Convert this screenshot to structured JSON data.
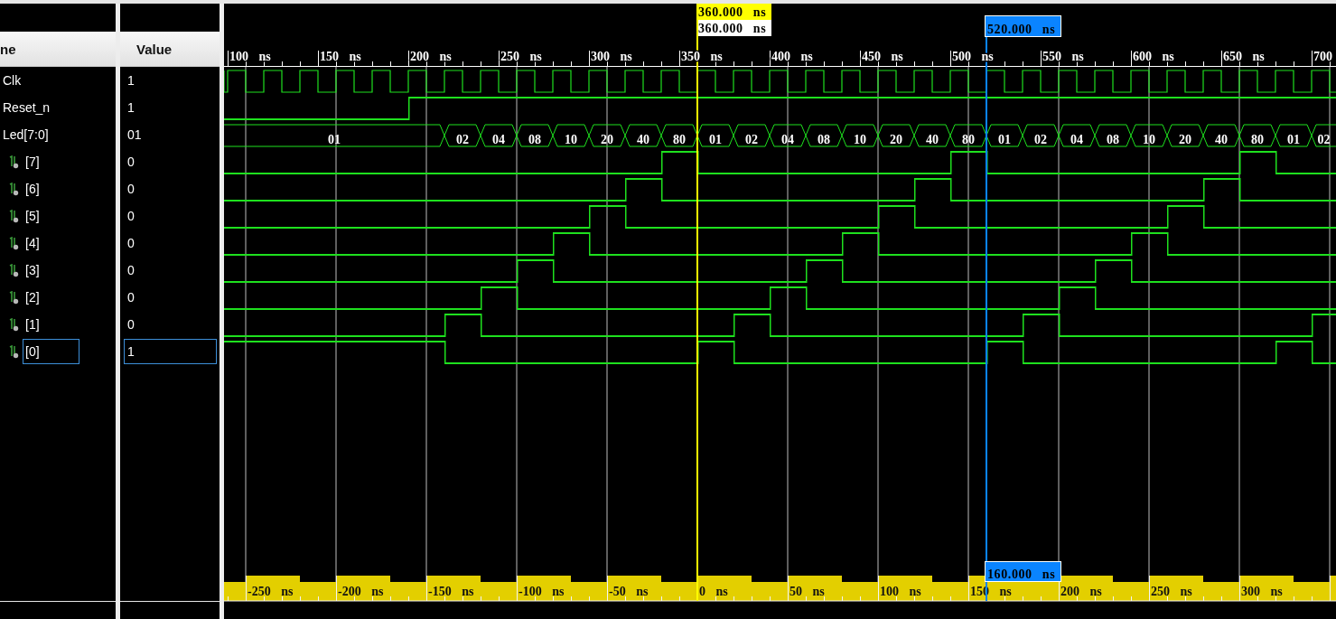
{
  "columns": {
    "name": "ne",
    "value": "Value"
  },
  "signals": [
    {
      "name": "Clk",
      "value": "1",
      "kind": "clock",
      "selected": false
    },
    {
      "name": "Reset_n",
      "value": "1",
      "kind": "bit",
      "selected": false,
      "high": [
        false,
        false,
        false,
        false,
        false,
        false,
        true,
        true,
        true,
        true,
        true,
        true,
        true,
        true,
        true,
        true,
        true,
        true,
        true,
        true,
        true,
        true,
        true,
        true,
        true,
        true,
        true,
        true,
        true,
        true,
        true,
        true
      ]
    },
    {
      "name": "Led[7:0]",
      "value": "01",
      "kind": "bus",
      "selected": false,
      "changes": [
        true,
        false,
        false,
        false,
        false,
        false,
        false,
        true,
        true,
        true,
        true,
        true,
        true,
        true,
        true,
        true,
        true,
        true,
        true,
        true,
        true,
        true,
        true,
        true,
        true,
        true,
        true,
        true,
        true,
        true,
        true,
        true
      ],
      "data": [
        "01",
        "02",
        "04",
        "08",
        "10",
        "20",
        "40",
        "80",
        "01",
        "02",
        "04",
        "08",
        "10",
        "20",
        "40",
        "80",
        "01",
        "02",
        "04",
        "08",
        "10",
        "20",
        "40",
        "80",
        "01",
        "02"
      ],
      "children": [
        {
          "name": "[7]",
          "value": "0",
          "kind": "bit",
          "selected": false,
          "high": [
            false,
            false,
            false,
            false,
            false,
            false,
            false,
            false,
            false,
            false,
            false,
            false,
            false,
            true,
            false,
            false,
            false,
            false,
            false,
            false,
            false,
            true,
            false,
            false,
            false,
            false,
            false,
            false,
            false,
            true,
            false,
            false
          ]
        },
        {
          "name": "[6]",
          "value": "0",
          "kind": "bit",
          "selected": false,
          "high": [
            false,
            false,
            false,
            false,
            false,
            false,
            false,
            false,
            false,
            false,
            false,
            false,
            true,
            false,
            false,
            false,
            false,
            false,
            false,
            false,
            true,
            false,
            false,
            false,
            false,
            false,
            false,
            false,
            true,
            false,
            false,
            false
          ]
        },
        {
          "name": "[5]",
          "value": "0",
          "kind": "bit",
          "selected": false,
          "high": [
            false,
            false,
            false,
            false,
            false,
            false,
            false,
            false,
            false,
            false,
            false,
            true,
            false,
            false,
            false,
            false,
            false,
            false,
            false,
            true,
            false,
            false,
            false,
            false,
            false,
            false,
            false,
            true,
            false,
            false,
            false,
            false
          ]
        },
        {
          "name": "[4]",
          "value": "0",
          "kind": "bit",
          "selected": false,
          "high": [
            false,
            false,
            false,
            false,
            false,
            false,
            false,
            false,
            false,
            false,
            true,
            false,
            false,
            false,
            false,
            false,
            false,
            false,
            true,
            false,
            false,
            false,
            false,
            false,
            false,
            false,
            true,
            false,
            false,
            false,
            false,
            false
          ]
        },
        {
          "name": "[3]",
          "value": "0",
          "kind": "bit",
          "selected": false,
          "high": [
            false,
            false,
            false,
            false,
            false,
            false,
            false,
            false,
            false,
            true,
            false,
            false,
            false,
            false,
            false,
            false,
            false,
            true,
            false,
            false,
            false,
            false,
            false,
            false,
            false,
            true,
            false,
            false,
            false,
            false,
            false,
            false
          ]
        },
        {
          "name": "[2]",
          "value": "0",
          "kind": "bit",
          "selected": false,
          "high": [
            false,
            false,
            false,
            false,
            false,
            false,
            false,
            false,
            true,
            false,
            false,
            false,
            false,
            false,
            false,
            false,
            true,
            false,
            false,
            false,
            false,
            false,
            false,
            false,
            true,
            false,
            false,
            false,
            false,
            false,
            false,
            false
          ]
        },
        {
          "name": "[1]",
          "value": "0",
          "kind": "bit",
          "selected": false,
          "high": [
            false,
            false,
            false,
            false,
            false,
            false,
            false,
            true,
            false,
            false,
            false,
            false,
            false,
            false,
            false,
            true,
            false,
            false,
            false,
            false,
            false,
            false,
            false,
            true,
            false,
            false,
            false,
            false,
            false,
            false,
            false,
            true
          ]
        },
        {
          "name": "[0]",
          "value": "1",
          "kind": "bit",
          "selected": true,
          "high": [
            true,
            true,
            true,
            true,
            true,
            true,
            true,
            false,
            false,
            false,
            false,
            false,
            false,
            false,
            true,
            false,
            false,
            false,
            false,
            false,
            false,
            false,
            true,
            false,
            false,
            false,
            false,
            false,
            false,
            false,
            true,
            false
          ]
        }
      ]
    }
  ],
  "ruler": {
    "labels": [
      "100 ns",
      "150 ns",
      "200 ns",
      "250 ns",
      "300 ns",
      "350 ns",
      "400 ns",
      "450 ns",
      "500 ns",
      "550 ns",
      "600 ns",
      "650 ns",
      "700"
    ]
  },
  "cursors": [
    {
      "kind": "main",
      "label": "360.000 ns",
      "value_label": "360.000 ns"
    },
    {
      "kind": "marker",
      "label": "520.000 ns",
      "delta_label": "160.000 ns"
    }
  ],
  "delta_ruler": {
    "labels": [
      "-250 ns",
      "-200 ns",
      "-150 ns",
      "-100 ns",
      "-50 ns",
      "0 ns",
      "50 ns",
      "100 ns",
      "150 ns",
      "200 ns",
      "250 ns",
      "300 ns"
    ]
  }
}
